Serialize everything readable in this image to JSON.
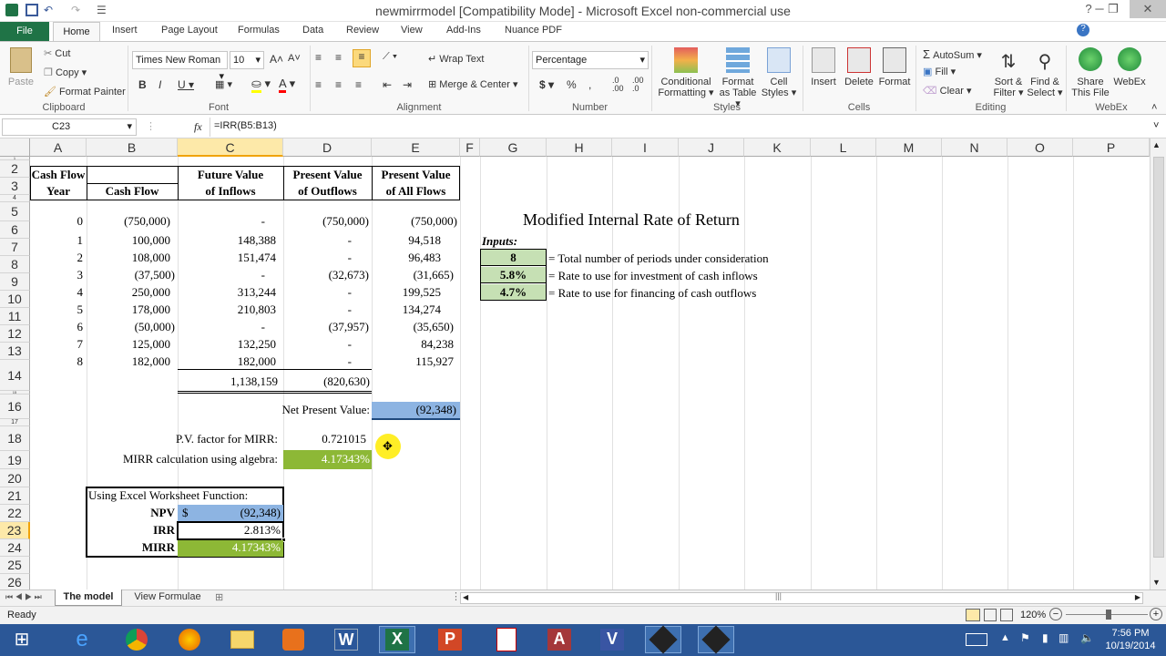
{
  "window": {
    "title": "newmirrmodel  [Compatibility Mode] - Microsoft Excel non-commercial use"
  },
  "tabs": [
    "File",
    "Home",
    "Insert",
    "Page Layout",
    "Formulas",
    "Data",
    "Review",
    "View",
    "Add-Ins",
    "Nuance PDF"
  ],
  "ribbon": {
    "clipboard": {
      "label": "Clipboard",
      "paste": "Paste",
      "cut": "Cut",
      "copy": "Copy",
      "format_painter": "Format Painter"
    },
    "font": {
      "label": "Font",
      "font_name": "Times New Roman",
      "font_size": "10"
    },
    "alignment": {
      "label": "Alignment",
      "wrap_text": "Wrap Text",
      "merge_center": "Merge & Center"
    },
    "number": {
      "label": "Number",
      "format": "Percentage"
    },
    "styles": {
      "label": "Styles",
      "conditional": "Conditional",
      "formatting": "Formatting",
      "format_as": "Format",
      "as_table": "as Table",
      "cell": "Cell",
      "cell_styles": "Styles"
    },
    "cells": {
      "label": "Cells",
      "insert": "Insert",
      "delete": "Delete",
      "format": "Format"
    },
    "editing": {
      "label": "Editing",
      "autosum": "AutoSum",
      "fill": "Fill",
      "clear": "Clear",
      "sort": "Sort &",
      "filter": "Filter",
      "find": "Find &",
      "select": "Select"
    },
    "webex": {
      "label": "WebEx",
      "share": "Share",
      "this_file": "This File",
      "webex_btn": "WebEx",
      "webex_btn2": "Ex"
    }
  },
  "formula_bar": {
    "name_box": "C23",
    "fx": "fx",
    "formula": "=IRR(B5:B13)"
  },
  "columns": [
    "A",
    "B",
    "C",
    "D",
    "E",
    "F",
    "G",
    "H",
    "I",
    "J",
    "K",
    "L",
    "M",
    "N",
    "O",
    "P"
  ],
  "rows": [
    "1",
    "2",
    "3",
    "4",
    "5",
    "6",
    "7",
    "8",
    "9",
    "10",
    "11",
    "12",
    "13",
    "14",
    "15",
    "16",
    "17",
    "18",
    "19",
    "20",
    "21",
    "22",
    "23",
    "24",
    "25",
    "26"
  ],
  "headers": {
    "a2": "Cash Flow",
    "a3": "Year",
    "b3": "Cash Flow",
    "c2": "Future Value",
    "c3": "of Inflows",
    "d2": "Present Value",
    "d3": "of Outflows",
    "e2": "Present Value",
    "e3": "of All Flows"
  },
  "table_rows": [
    {
      "year": "0",
      "cf": "(750,000)",
      "fv": "-",
      "pvo": "(750,000)",
      "pva": "(750,000)"
    },
    {
      "year": "1",
      "cf": "100,000",
      "fv": "148,388",
      "pvo": "-",
      "pva": "94,518"
    },
    {
      "year": "2",
      "cf": "108,000",
      "fv": "151,474",
      "pvo": "-",
      "pva": "96,483"
    },
    {
      "year": "3",
      "cf": "(37,500)",
      "fv": "-",
      "pvo": "(32,673)",
      "pva": "(31,665)"
    },
    {
      "year": "4",
      "cf": "250,000",
      "fv": "313,244",
      "pvo": "-",
      "pva": "199,525"
    },
    {
      "year": "5",
      "cf": "178,000",
      "fv": "210,803",
      "pvo": "-",
      "pva": "134,274"
    },
    {
      "year": "6",
      "cf": "(50,000)",
      "fv": "-",
      "pvo": "(37,957)",
      "pva": "(35,650)"
    },
    {
      "year": "7",
      "cf": "125,000",
      "fv": "132,250",
      "pvo": "-",
      "pva": "84,238"
    },
    {
      "year": "8",
      "cf": "182,000",
      "fv": "182,000",
      "pvo": "-",
      "pva": "115,927"
    }
  ],
  "totals": {
    "fv": "1,138,159",
    "pvo": "(820,630)"
  },
  "npv": {
    "label": "Net Present Value:",
    "value": "(92,348)"
  },
  "pv_factor": {
    "label": "P.V. factor for MIRR:",
    "value": "0.721015"
  },
  "mirr_alg": {
    "label": "MIRR calculation using algebra:",
    "value": "4.17343%"
  },
  "excel_fn": {
    "title": "Using Excel Worksheet Function:",
    "npv_label": "NPV",
    "npv_dollar": "$",
    "npv_value": "(92,348)",
    "irr_label": "IRR",
    "irr_value": "2.813%",
    "mirr_label": "MIRR",
    "mirr_value": "4.17343%"
  },
  "mirr_panel": {
    "title": "Modified Internal Rate of Return",
    "inputs_label": "Inputs:",
    "inputs": [
      {
        "value": "8",
        "desc": "= Total number of periods under consideration"
      },
      {
        "value": "5.8%",
        "desc": "= Rate to use for investment of cash inflows"
      },
      {
        "value": "4.7%",
        "desc": "= Rate to use for financing of cash outflows"
      }
    ]
  },
  "sheets": [
    "The model",
    "View Formulae"
  ],
  "status": {
    "ready": "Ready",
    "zoom": "120%"
  },
  "clock": {
    "time": "7:56 PM",
    "date": "10/19/2014"
  },
  "colors": {
    "excel_green": "#1f7346",
    "input_green": "#c6e0b4",
    "result_green": "#8db836",
    "npv_blue": "#8db4e2",
    "taskbar": "#2b5797"
  }
}
